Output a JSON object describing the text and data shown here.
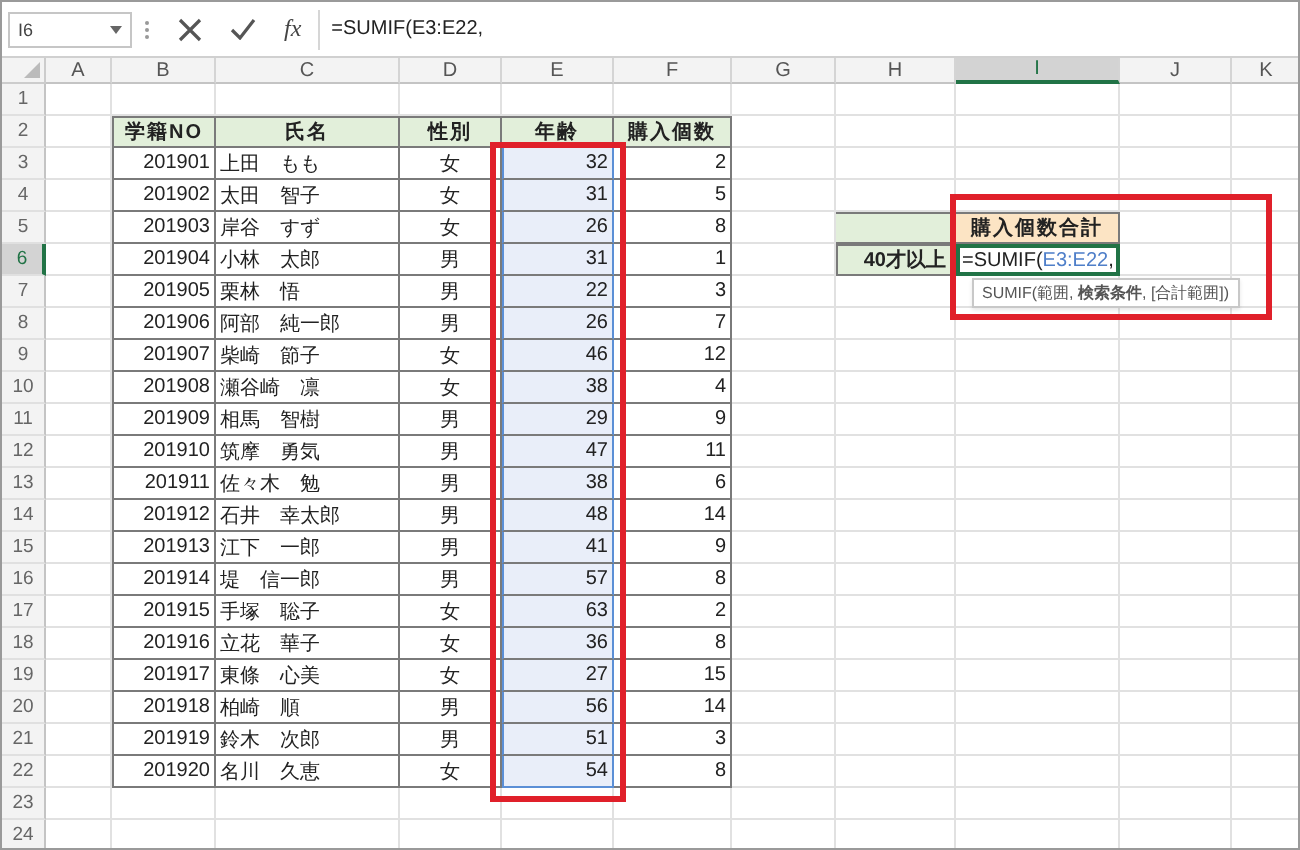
{
  "formula_bar": {
    "name_box": "I6",
    "function_label": "fx",
    "formula": "=SUMIF(E3:E22,"
  },
  "column_headers": [
    {
      "label": "A",
      "selected": false
    },
    {
      "label": "B",
      "selected": false
    },
    {
      "label": "C",
      "selected": false
    },
    {
      "label": "D",
      "selected": false
    },
    {
      "label": "E",
      "selected": false
    },
    {
      "label": "F",
      "selected": false
    },
    {
      "label": "G",
      "selected": false
    },
    {
      "label": "H",
      "selected": false
    },
    {
      "label": "I",
      "selected": true
    },
    {
      "label": "J",
      "selected": false
    },
    {
      "label": "K",
      "selected": false
    }
  ],
  "row_headers": [
    {
      "label": "1",
      "selected": false
    },
    {
      "label": "2",
      "selected": false
    },
    {
      "label": "3",
      "selected": false
    },
    {
      "label": "4",
      "selected": false
    },
    {
      "label": "5",
      "selected": false
    },
    {
      "label": "6",
      "selected": true
    },
    {
      "label": "7",
      "selected": false
    },
    {
      "label": "8",
      "selected": false
    },
    {
      "label": "9",
      "selected": false
    },
    {
      "label": "10",
      "selected": false
    },
    {
      "label": "11",
      "selected": false
    },
    {
      "label": "12",
      "selected": false
    },
    {
      "label": "13",
      "selected": false
    },
    {
      "label": "14",
      "selected": false
    },
    {
      "label": "15",
      "selected": false
    },
    {
      "label": "16",
      "selected": false
    },
    {
      "label": "17",
      "selected": false
    },
    {
      "label": "18",
      "selected": false
    },
    {
      "label": "19",
      "selected": false
    },
    {
      "label": "20",
      "selected": false
    },
    {
      "label": "21",
      "selected": false
    },
    {
      "label": "22",
      "selected": false
    },
    {
      "label": "23",
      "selected": false
    },
    {
      "label": "24",
      "selected": false
    }
  ],
  "table": {
    "columns": [
      {
        "label": "学籍NO",
        "kind": "number",
        "highlighted": false
      },
      {
        "label": "氏名",
        "kind": "text",
        "highlighted": false
      },
      {
        "label": "性別",
        "kind": "category",
        "highlighted": false
      },
      {
        "label": "年齢",
        "kind": "number",
        "highlighted": true
      },
      {
        "label": "購入個数",
        "kind": "number",
        "highlighted": false
      }
    ],
    "rows": [
      [
        "201901",
        "上田　もも",
        "女",
        "32",
        "2"
      ],
      [
        "201902",
        "太田　智子",
        "女",
        "31",
        "5"
      ],
      [
        "201903",
        "岸谷　すず",
        "女",
        "26",
        "8"
      ],
      [
        "201904",
        "小林　太郎",
        "男",
        "31",
        "1"
      ],
      [
        "201905",
        "栗林　悟",
        "男",
        "22",
        "3"
      ],
      [
        "201906",
        "阿部　純一郎",
        "男",
        "26",
        "7"
      ],
      [
        "201907",
        "柴崎　節子",
        "女",
        "46",
        "12"
      ],
      [
        "201908",
        "瀬谷崎　凛",
        "女",
        "38",
        "4"
      ],
      [
        "201909",
        "相馬　智樹",
        "男",
        "29",
        "9"
      ],
      [
        "201910",
        "筑摩　勇気",
        "男",
        "47",
        "11"
      ],
      [
        "201911",
        "佐々木　勉",
        "男",
        "38",
        "6"
      ],
      [
        "201912",
        "石井　幸太郎",
        "男",
        "48",
        "14"
      ],
      [
        "201913",
        "江下　一郎",
        "男",
        "41",
        "9"
      ],
      [
        "201914",
        "堤　信一郎",
        "男",
        "57",
        "8"
      ],
      [
        "201915",
        "手塚　聡子",
        "女",
        "63",
        "2"
      ],
      [
        "201916",
        "立花　華子",
        "女",
        "36",
        "8"
      ],
      [
        "201917",
        "東條　心美",
        "女",
        "27",
        "15"
      ],
      [
        "201918",
        "柏崎　順",
        "男",
        "56",
        "14"
      ],
      [
        "201919",
        "鈴木　次郎",
        "男",
        "51",
        "3"
      ],
      [
        "201920",
        "名川　久恵",
        "女",
        "54",
        "8"
      ]
    ]
  },
  "summary": {
    "header": "購入個数合計",
    "row_label": "40才以上",
    "formula_parts": [
      {
        "text": "=SUMIF(",
        "kind": "plain"
      },
      {
        "text": "E3:E22",
        "kind": "reference"
      },
      {
        "text": ",",
        "kind": "plain"
      }
    ],
    "tooltip": "SUMIF(範囲, **検索条件**, [合計範囲])"
  }
}
